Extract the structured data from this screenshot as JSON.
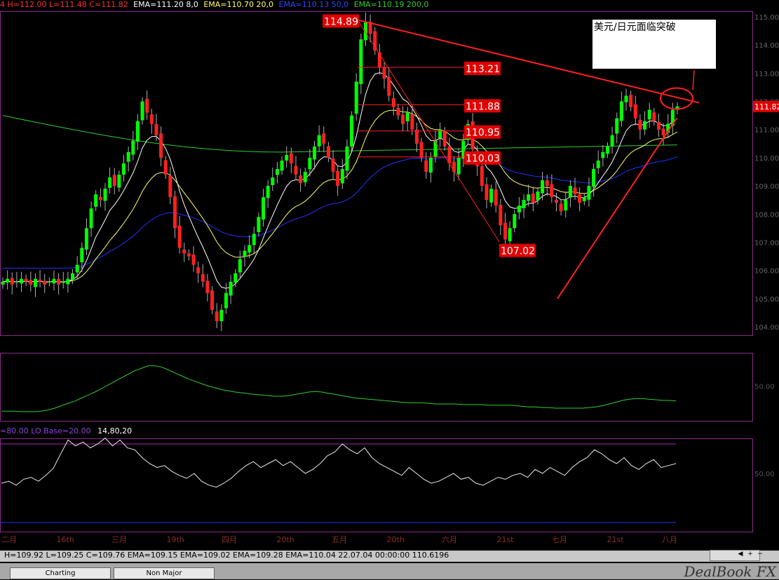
{
  "header": {
    "ohlc": "4 H=112.00 L=111.48 C=111.82",
    "ema1": "EMA=111.20  8,0",
    "ema2": "EMA=110.70  20,0",
    "ema3": "EMA=110.13  50,0",
    "ema4": "EMA=110.19  200,0"
  },
  "note": "美元/日元面临突破",
  "osc2_label": {
    "a": "=80.00 LO Base=20.00",
    "b": "14,80,20"
  },
  "status": "H=109.92 L=109.25 C=109.76 EMA=109.15 EMA=109.02 EMA=109.28 EMA=110.04 22.07.04 00:00:00 110.6196",
  "tabs": [
    "Charting",
    "Non Major"
  ],
  "logo": "DealBook FX",
  "colors": {
    "up": "#00ff00",
    "down": "#ff2020",
    "ema8": "#ffffff",
    "ema20": "#ffff66",
    "ema50": "#2233ff",
    "ema200": "#33cc33",
    "trend": "#ff2020",
    "frame": "#8a2a8a"
  },
  "chart_data": {
    "type": "candlestick",
    "price_axis": {
      "ylim": [
        103.7,
        115.2
      ],
      "ticks": [
        "115.00",
        "114.00",
        "113.00",
        "112.00",
        "111.00",
        "110.00",
        "109.00",
        "108.00",
        "107.00",
        "106.00",
        "105.00",
        "104.00"
      ]
    },
    "last_price": "111.82",
    "time_labels": [
      "二月",
      "16th",
      "三月",
      "19th",
      "四月",
      "20th",
      "五月",
      "20th",
      "六月",
      "21st",
      "七月",
      "21st",
      "八月"
    ],
    "annotations": [
      "114.89",
      "113.21",
      "111.88",
      "110.95",
      "110.03",
      "107.02"
    ],
    "osc1_tick": "50.00",
    "osc2_tick": "50.00",
    "close": [
      105.6,
      105.7,
      105.5,
      105.6,
      105.7,
      105.6,
      105.5,
      105.7,
      105.6,
      105.5,
      105.6,
      105.7,
      105.5,
      105.6,
      105.7,
      105.9,
      106.2,
      106.8,
      107.5,
      108.2,
      108.7,
      108.5,
      108.9,
      109.3,
      109.0,
      109.4,
      109.8,
      110.2,
      110.6,
      111.3,
      112.0,
      111.6,
      111.2,
      110.8,
      110.0,
      109.4,
      108.6,
      107.5,
      106.8,
      106.6,
      106.5,
      106.2,
      105.9,
      105.6,
      105.2,
      104.6,
      104.2,
      104.6,
      105.2,
      105.6,
      105.9,
      106.4,
      106.7,
      106.9,
      107.3,
      107.9,
      108.6,
      109.0,
      109.3,
      109.6,
      109.9,
      110.1,
      109.8,
      109.4,
      109.1,
      109.5,
      110.0,
      110.4,
      110.8,
      110.5,
      110.0,
      109.5,
      109.0,
      109.6,
      110.4,
      111.5,
      112.7,
      114.2,
      114.8,
      114.4,
      113.8,
      113.2,
      112.8,
      112.2,
      111.8,
      111.5,
      111.2,
      111.6,
      111.0,
      110.5,
      110.0,
      109.5,
      110.0,
      110.6,
      111.0,
      110.4,
      109.8,
      109.5,
      110.0,
      110.6,
      111.2,
      110.3,
      109.7,
      109.0,
      108.5,
      108.9,
      108.3,
      107.6,
      107.1,
      107.5,
      108.0,
      108.3,
      108.5,
      108.7,
      108.4,
      108.8,
      109.2,
      109.0,
      108.6,
      108.4,
      108.1,
      108.5,
      109.0,
      108.7,
      108.4,
      108.6,
      109.0,
      109.6,
      109.9,
      110.2,
      110.4,
      110.8,
      111.4,
      112.0,
      112.2,
      111.8,
      111.4,
      111.0,
      111.3,
      111.7,
      111.3,
      111.0,
      110.8,
      111.2,
      111.7,
      111.82
    ],
    "osc1": [
      8,
      8,
      8,
      7,
      7,
      7,
      8,
      10,
      13,
      17,
      21,
      25,
      30,
      35,
      40,
      46,
      52,
      58,
      64,
      70,
      76,
      80,
      84,
      84,
      82,
      77,
      72,
      67,
      62,
      58,
      54,
      50,
      47,
      44,
      42,
      40,
      39,
      37,
      36,
      35,
      34,
      33,
      33,
      34,
      36,
      38,
      40,
      41,
      40,
      38,
      36,
      34,
      32,
      30,
      29,
      28,
      27,
      26,
      25,
      24,
      23,
      22,
      22,
      22,
      21,
      20,
      20,
      20,
      20,
      19,
      19,
      19,
      19,
      18,
      18,
      18,
      18,
      17,
      16,
      15,
      15,
      14,
      14,
      13,
      13,
      13,
      13,
      13,
      14,
      15,
      17,
      20,
      23,
      26,
      28,
      29,
      29,
      28,
      27,
      26,
      26,
      25
    ],
    "osc2": [
      40,
      42,
      38,
      44,
      46,
      42,
      48,
      55,
      70,
      84,
      78,
      82,
      76,
      80,
      86,
      78,
      84,
      76,
      74,
      66,
      60,
      56,
      58,
      52,
      48,
      45,
      50,
      42,
      38,
      36,
      40,
      45,
      52,
      58,
      62,
      56,
      60,
      64,
      58,
      62,
      56,
      50,
      54,
      60,
      68,
      72,
      80,
      74,
      70,
      76,
      66,
      60,
      56,
      52,
      48,
      56,
      50,
      44,
      40,
      42,
      46,
      50,
      44,
      46,
      40,
      38,
      42,
      46,
      44,
      48,
      50,
      46,
      54,
      50,
      56,
      52,
      48,
      56,
      62,
      66,
      74,
      70,
      64,
      60,
      66,
      58,
      54,
      60,
      64,
      56,
      58,
      60
    ],
    "osc2_levels": [
      80,
      20
    ]
  }
}
